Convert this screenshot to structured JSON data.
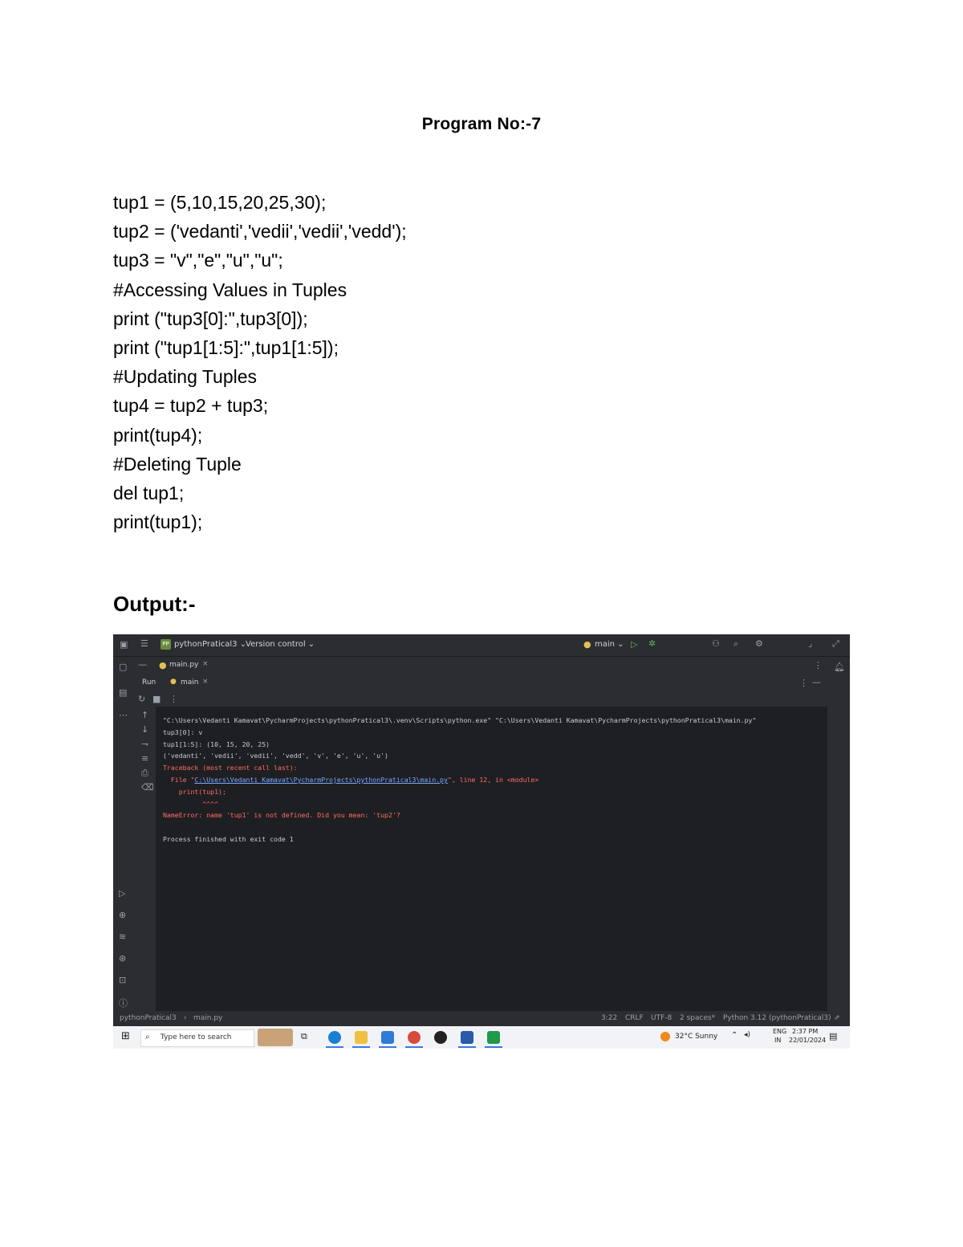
{
  "title": "Program No:-7",
  "code_lines": [
    "tup1 = (5,10,15,20,25,30);",
    "tup2 = ('vedanti','vedii','vedii','vedd');",
    "tup3 = \"v\",\"e\",\"u\",\"u\";",
    "#Accessing Values in Tuples",
    "print (\"tup3[0]:\",tup3[0]);",
    "print (\"tup1[1:5]:\",tup1[1:5]);",
    "#Updating Tuples",
    "tup4 = tup2 + tup3;",
    "print(tup4);",
    "#Deleting Tuple",
    "del tup1;",
    "print(tup1);"
  ],
  "output_heading": "Output:-",
  "ide": {
    "project_badge": "PP",
    "project_name": "pythonPratical3 ⌄",
    "version_control": "Version control ⌄",
    "run_config": "main ⌄",
    "file_tab": "main.py",
    "run_label": "Run",
    "run_tab": "main",
    "console": {
      "cmd": "\"C:\\Users\\Vedanti Kamavat\\PycharmProjects\\pythonPratical3\\.venv\\Scripts\\python.exe\" \"C:\\Users\\Vedanti Kamavat\\PycharmProjects\\pythonPratical3\\main.py\"",
      "line1": "tup3[0]: v",
      "line2": "tup1[1:5]: (10, 15, 20, 25)",
      "line3": "('vedanti', 'vedii', 'vedii', 'vedd', 'v', 'e', 'u', 'u')",
      "tb_head": "Traceback (most recent call last):",
      "tb_file_pre": "  File \"",
      "tb_file_path": "C:\\Users\\Vedanti Kamavat\\PycharmProjects\\pythonPratical3\\main.py",
      "tb_file_post": "\", line 12, in <module>",
      "tb_code": "    print(tup1);",
      "tb_caret": "          ^^^^",
      "error": "NameError: name 'tup1' is not defined. Did you mean: 'tup2'?",
      "exit": "Process finished with exit code 1"
    },
    "status": {
      "breadcrumb_project": "pythonPratical3",
      "breadcrumb_file": "main.py",
      "position": "3:22",
      "line_sep": "CRLF",
      "encoding": "UTF-8",
      "indent": "2 spaces*",
      "interpreter": "Python 3.12 (pythonPratical3)"
    },
    "taskbar": {
      "search_placeholder": "Type here to search",
      "weather": "32°C  Sunny",
      "lang": "ENG",
      "region": "IN",
      "time": "2:37 PM",
      "date": "22/01/2024"
    },
    "colors": {
      "background": "#1e1f22",
      "panel": "#2b2d30",
      "error": "#ff6b68",
      "link": "#7aa7ff"
    }
  }
}
